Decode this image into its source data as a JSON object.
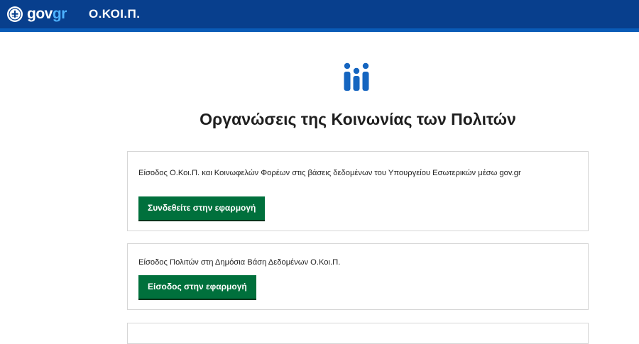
{
  "header": {
    "logo": {
      "text_main": "gov",
      "text_accent": "gr"
    },
    "app_name": "Ο.ΚΟΙ.Π."
  },
  "main": {
    "icon": "people-group-icon",
    "title": "Οργανώσεις της Κοινωνίας των Πολιτών",
    "cards": [
      {
        "text": "Είσοδος Ο.Κοι.Π. και Κοινωφελών Φορέων στις βάσεις δεδομένων του Υπουργείου Εσωτερικών μέσω gov.gr",
        "button_label": "Συνδεθείτε στην εφαρμογή"
      },
      {
        "text": "Είσοδος Πολιτών στη Δημόσια Βάση Δεδομένων Ο.Κοι.Π.",
        "button_label": "Είσοδος στην εφαρμογή"
      }
    ]
  },
  "colors": {
    "header_bg": "#083f8d",
    "header_stripe": "#0a5bb7",
    "logo_accent": "#4db2ff",
    "icon_blue": "#1565c0",
    "button_green": "#00703c"
  }
}
